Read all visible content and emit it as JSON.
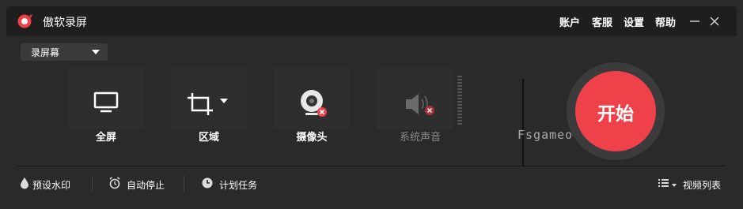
{
  "app": {
    "title": "傲软录屏"
  },
  "topbar": {
    "account": "账户",
    "support": "客服",
    "settings": "设置",
    "help": "帮助"
  },
  "mode_select": {
    "value": "录屏幕"
  },
  "sources": [
    {
      "label": "全屏",
      "icon": "monitor-icon"
    },
    {
      "label": "区域",
      "icon": "crop-icon"
    },
    {
      "label": "摄像头",
      "icon": "webcam-icon",
      "status": "disabled"
    },
    {
      "label": "系统声音",
      "icon": "speaker-muted-icon",
      "status": "disabled"
    }
  ],
  "start_button": {
    "label": "开始"
  },
  "watermark_text": "Fsgameo.com",
  "bottombar": {
    "watermark": "预设水印",
    "auto_stop": "自动停止",
    "schedule": "计划任务",
    "video_list": "视频列表"
  },
  "colors": {
    "accent": "#ee4149",
    "background": "#2a2a2a",
    "titlebar": "#1e1e1e"
  }
}
